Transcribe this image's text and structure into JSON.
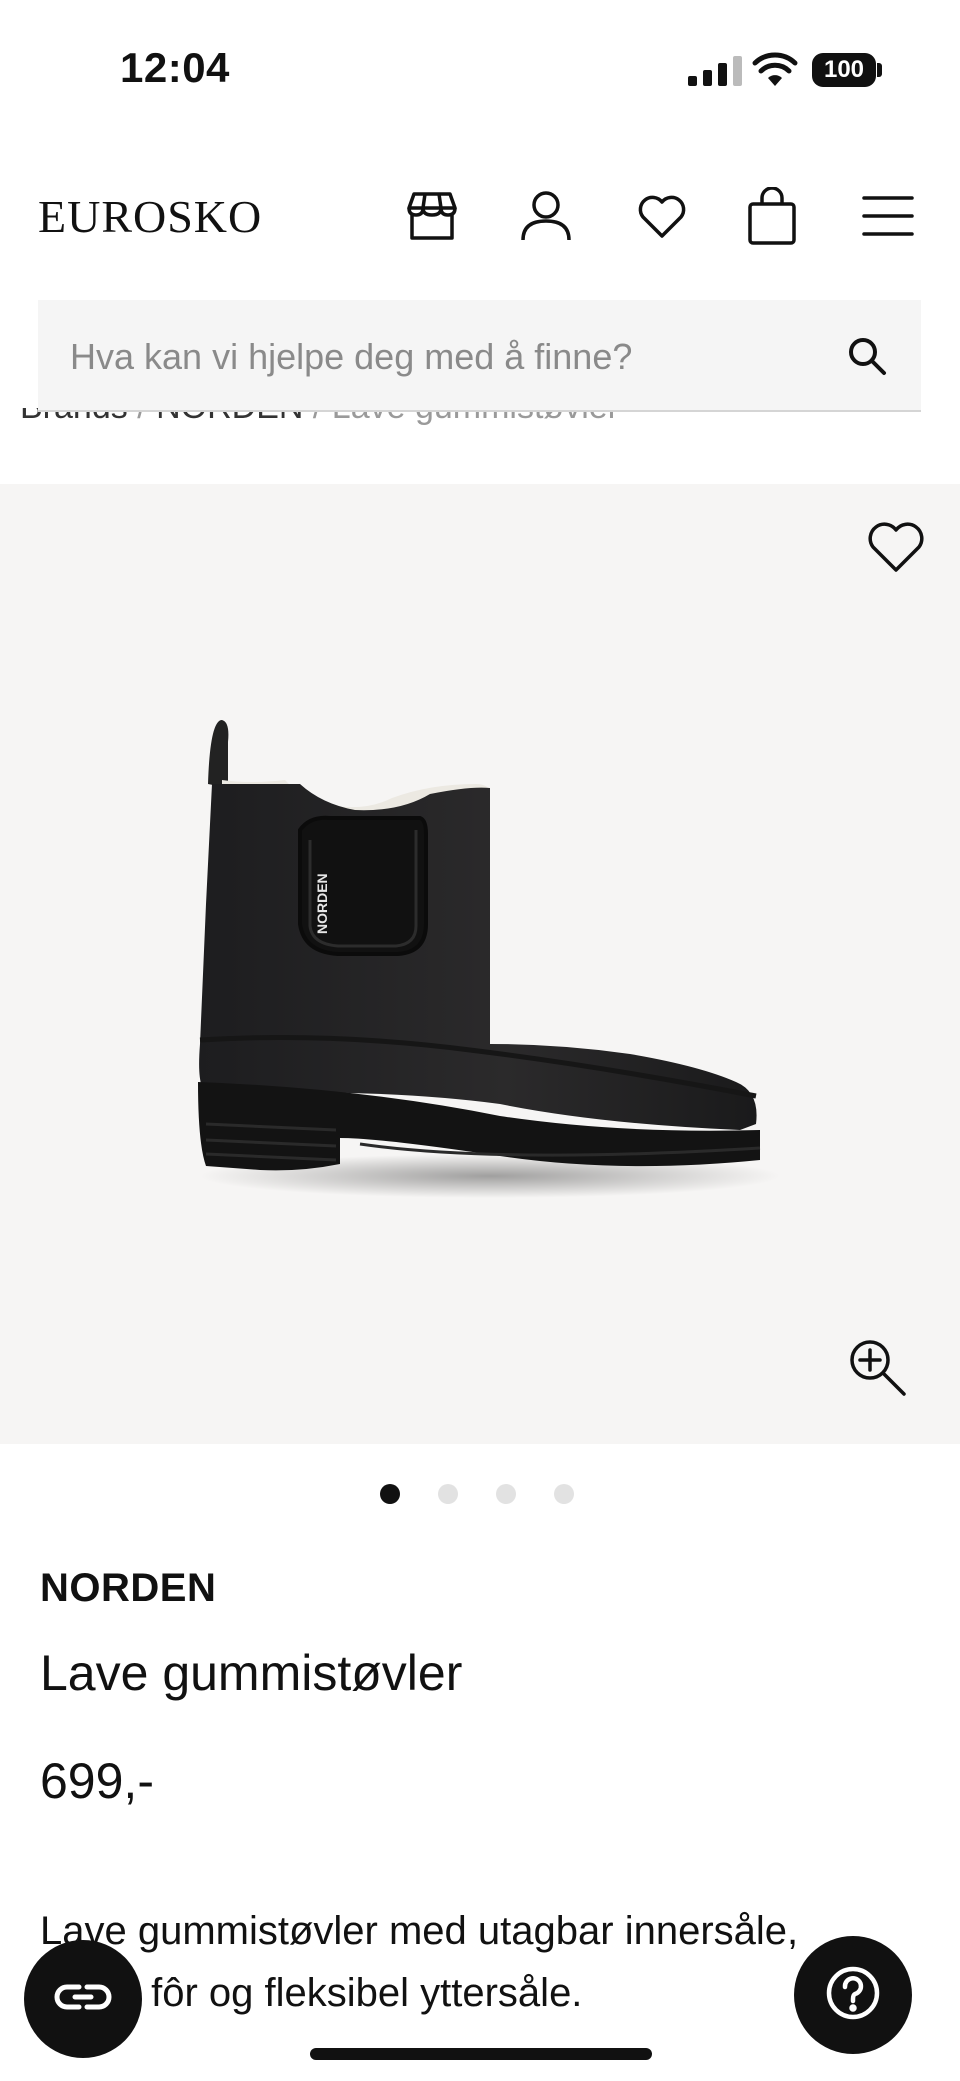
{
  "status_bar": {
    "time": "12:04",
    "battery": "100"
  },
  "header": {
    "logo": "EUROSKO",
    "icons": [
      "store-icon",
      "user-icon",
      "heart-icon",
      "bag-icon",
      "menu-icon"
    ]
  },
  "search": {
    "placeholder": "Hva kan vi hjelpe deg med å finne?",
    "icon": "search-icon"
  },
  "breadcrumb": {
    "items": [
      "Brands",
      "NORDEN",
      "Lave gummistøvler"
    ],
    "separator": "/"
  },
  "gallery": {
    "image_count": 4,
    "active_index": 0,
    "boot_label": "NORDEN"
  },
  "product": {
    "brand": "NORDEN",
    "name": "Lave gummistøvler",
    "price": "699,-",
    "description": "Lave gummistøvler med utagbar innersåle, varmt fôr og fleksibel yttersåle."
  },
  "floating": {
    "left_icon": "chat-link-icon",
    "right_icon": "help-icon"
  },
  "colors": {
    "accent": "#111111",
    "image_background": "#f6f5f4",
    "search_background": "#f5f5f5"
  }
}
